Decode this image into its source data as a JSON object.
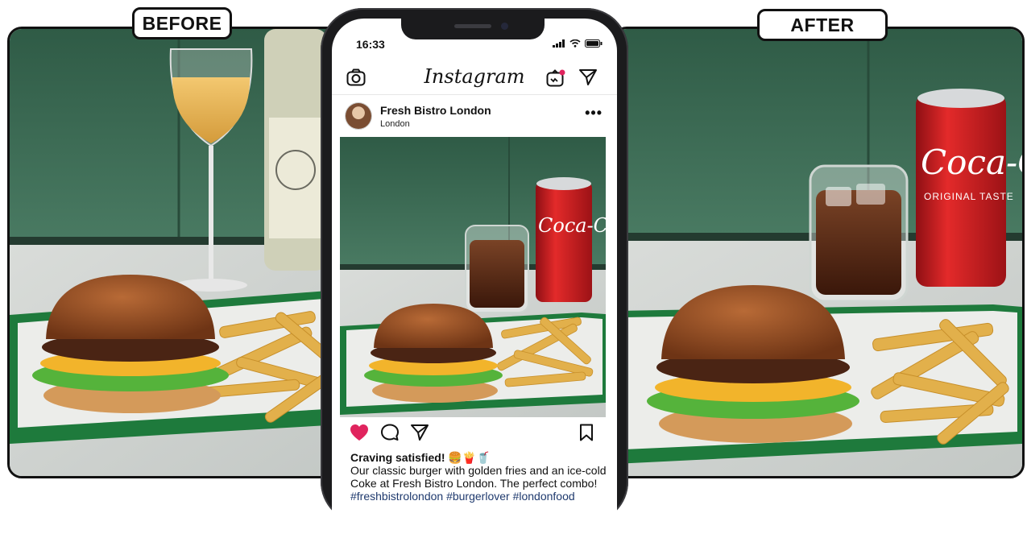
{
  "labels": {
    "before": "BEFORE",
    "after": "AFTER"
  },
  "phone": {
    "status_time": "16:33",
    "app_name": "Instagram",
    "post": {
      "account_name": "Fresh Bistro London",
      "location": "London",
      "more_label": "•••",
      "caption_title": "Craving satisfied! 🍔🍟🥤",
      "caption_body": "Our classic burger with golden fries and an ice-cold Coke at Fresh Bistro London. The perfect combo!",
      "hashtag_1": "#freshbistrolondon",
      "hashtag_2": "#burgerlover",
      "hashtag_3": "#londonfood"
    }
  },
  "colors": {
    "wall_green": "#3f6e57",
    "tray_green": "#1f7a3e",
    "like_red": "#e0245e",
    "hashtag_blue": "#1f3a6e"
  },
  "icons": {
    "header_left": "camera-icon",
    "header_right_1": "igtv-icon",
    "header_right_2": "direct-message-icon",
    "action_1": "heart-icon",
    "action_2": "comment-icon",
    "action_3": "share-icon",
    "action_4": "bookmark-icon"
  }
}
